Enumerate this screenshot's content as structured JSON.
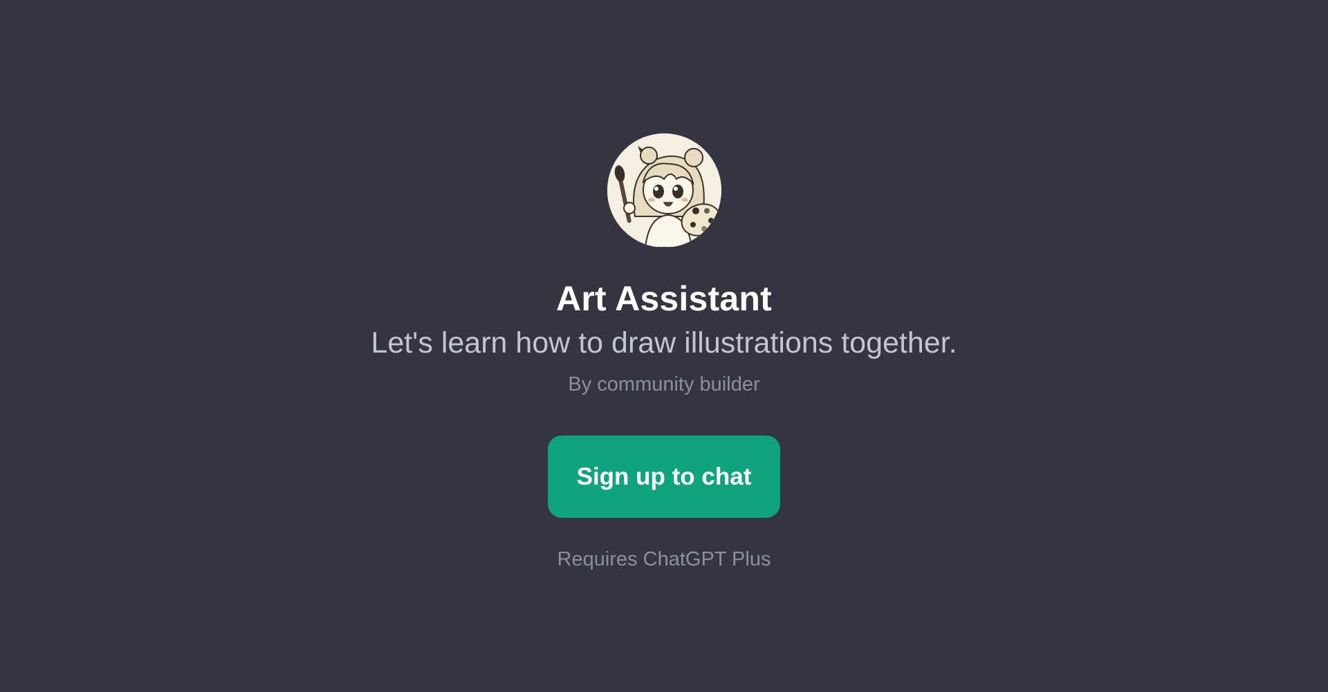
{
  "gpt": {
    "avatar_icon": "anime-artist-girl-avatar",
    "title": "Art Assistant",
    "description": "Let's learn how to draw illustrations together.",
    "author": "By community builder"
  },
  "cta": {
    "label": "Sign up to chat"
  },
  "requirement": "Requires ChatGPT Plus",
  "colors": {
    "background": "#343541",
    "accent": "#10a37f",
    "title": "#ffffff",
    "subtitle": "#c5c5d2",
    "muted": "#8e8ea0"
  }
}
